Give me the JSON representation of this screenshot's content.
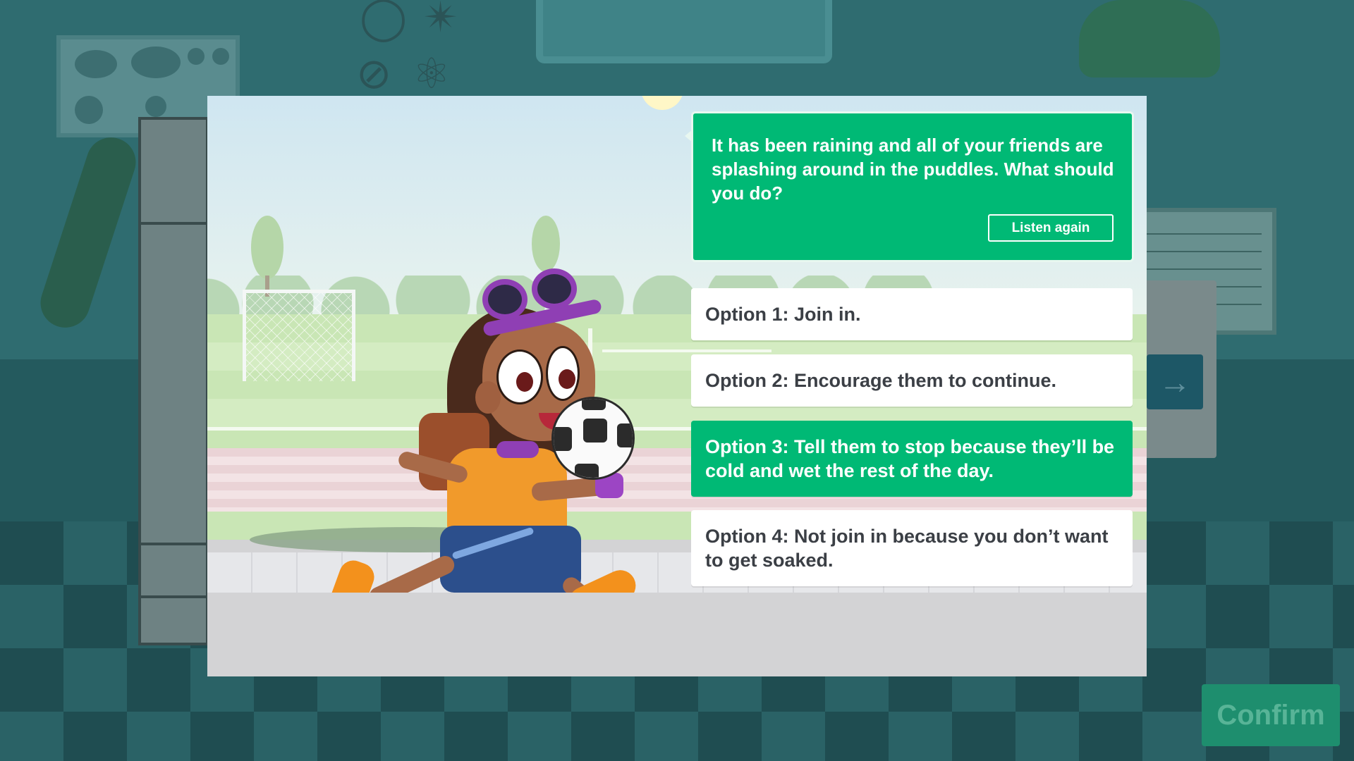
{
  "prompt": {
    "text": "It has been raining and all of your friends are splashing around in the puddles. What should you do?",
    "listen_label": "Listen again"
  },
  "options": [
    {
      "label": "Option 1: Join in.",
      "selected": false
    },
    {
      "label": "Option 2: Encourage them to continue.",
      "selected": false
    },
    {
      "label": "Option 3: Tell them to stop because they’ll be cold and wet the rest of the day.",
      "selected": true
    },
    {
      "label": "Option 4: Not join in because you don’t want to get soaked.",
      "selected": false
    }
  ],
  "confirm_label": "Confirm",
  "next_icon": "arrow-right-icon",
  "colors": {
    "accent_green": "#00b975",
    "option_text": "#3b3f45",
    "confirm_bg": "#1e8e6e"
  }
}
